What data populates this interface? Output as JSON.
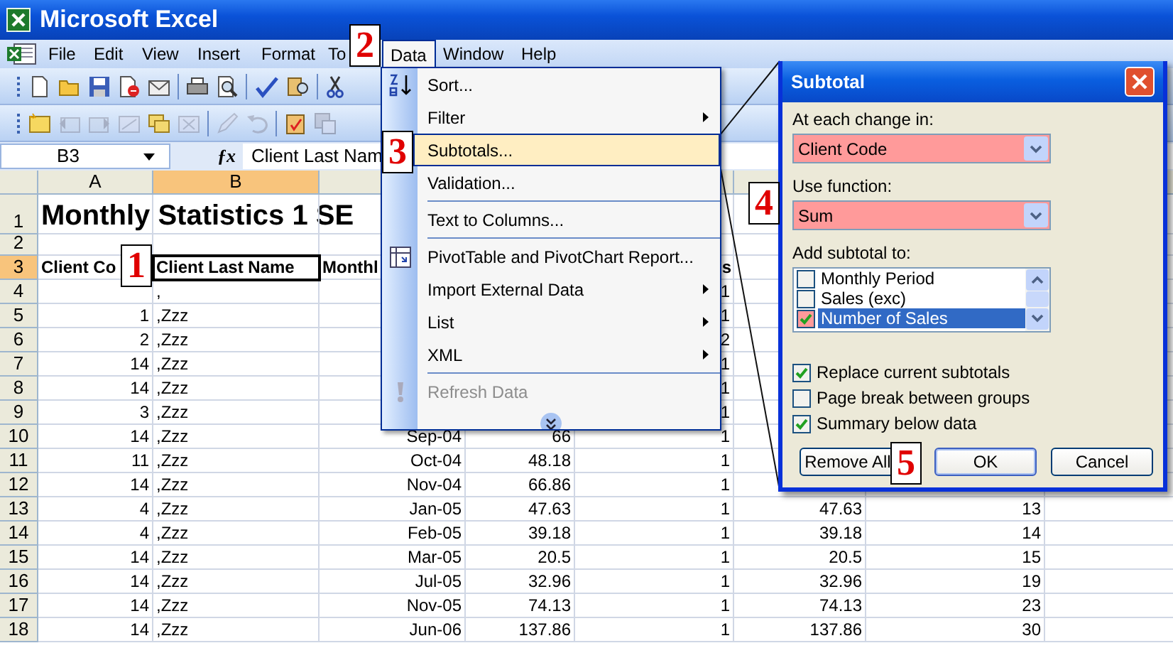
{
  "window": {
    "title": "Microsoft Excel"
  },
  "menu_bar": [
    {
      "label": "File",
      "selected": false
    },
    {
      "label": "Edit",
      "selected": false
    },
    {
      "label": "View",
      "selected": false
    },
    {
      "label": "Insert",
      "selected": false
    },
    {
      "label": "Format",
      "selected": false
    },
    {
      "label": "To",
      "selected": false
    },
    {
      "label": "Data",
      "selected": true
    },
    {
      "label": "Window",
      "selected": false
    },
    {
      "label": "Help",
      "selected": false
    }
  ],
  "name_box": "B3",
  "function_icon": "ƒx",
  "formula": "Client Last Nam",
  "sheet": {
    "columns": [
      {
        "label": "A",
        "selected": false
      },
      {
        "label": "B",
        "selected": true
      }
    ],
    "rows": [
      {
        "number": "1",
        "kind": "title",
        "selected": false,
        "cells": {
          "A": "Monthly Statistics 1 SE"
        }
      },
      {
        "number": "2",
        "kind": "data",
        "selected": false,
        "cells": {}
      },
      {
        "number": "3",
        "kind": "header",
        "selected": true,
        "cells": {
          "A": "Client Co",
          "B": "Client Last Name",
          "C": "Monthl",
          "E": "s"
        }
      },
      {
        "number": "4",
        "kind": "data",
        "selected": false,
        "cells": {
          "B": ",",
          "E": "1"
        }
      },
      {
        "number": "5",
        "kind": "data",
        "selected": false,
        "cells": {
          "A": "1",
          "B": ",Zzz",
          "E": "1"
        }
      },
      {
        "number": "6",
        "kind": "data",
        "selected": false,
        "cells": {
          "A": "2",
          "B": ",Zzz",
          "E": "2"
        }
      },
      {
        "number": "7",
        "kind": "data",
        "selected": false,
        "cells": {
          "A": "14",
          "B": ",Zzz",
          "E": "1"
        }
      },
      {
        "number": "8",
        "kind": "data",
        "selected": false,
        "cells": {
          "A": "14",
          "B": ",Zzz",
          "E": "1"
        }
      },
      {
        "number": "9",
        "kind": "data",
        "selected": false,
        "cells": {
          "A": "3",
          "B": ",Zzz",
          "E": "1"
        }
      },
      {
        "number": "10",
        "kind": "data",
        "selected": false,
        "cells": {
          "A": "14",
          "B": ",Zzz",
          "C": "Sep-04",
          "D": "66",
          "E": "1"
        }
      },
      {
        "number": "11",
        "kind": "data",
        "selected": false,
        "cells": {
          "A": "11",
          "B": ",Zzz",
          "C": "Oct-04",
          "D": "48.18",
          "E": "1"
        }
      },
      {
        "number": "12",
        "kind": "data",
        "selected": false,
        "cells": {
          "A": "14",
          "B": ",Zzz",
          "C": "Nov-04",
          "D": "66.86",
          "E": "1"
        }
      },
      {
        "number": "13",
        "kind": "data",
        "selected": false,
        "cells": {
          "A": "4",
          "B": ",Zzz",
          "C": "Jan-05",
          "D": "47.63",
          "E": "1",
          "F": "47.63",
          "G": "13"
        }
      },
      {
        "number": "14",
        "kind": "data",
        "selected": false,
        "cells": {
          "A": "4",
          "B": ",Zzz",
          "C": "Feb-05",
          "D": "39.18",
          "E": "1",
          "F": "39.18",
          "G": "14"
        }
      },
      {
        "number": "15",
        "kind": "data",
        "selected": false,
        "cells": {
          "A": "14",
          "B": ",Zzz",
          "C": "Mar-05",
          "D": "20.5",
          "E": "1",
          "F": "20.5",
          "G": "15"
        }
      },
      {
        "number": "16",
        "kind": "data",
        "selected": false,
        "cells": {
          "A": "14",
          "B": ",Zzz",
          "C": "Jul-05",
          "D": "32.96",
          "E": "1",
          "F": "32.96",
          "G": "19"
        }
      },
      {
        "number": "17",
        "kind": "data",
        "selected": false,
        "cells": {
          "A": "14",
          "B": ",Zzz",
          "C": "Nov-05",
          "D": "74.13",
          "E": "1",
          "F": "74.13",
          "G": "23"
        }
      },
      {
        "number": "18",
        "kind": "data",
        "selected": false,
        "cells": {
          "A": "14",
          "B": ",Zzz",
          "C": "Jun-06",
          "D": "137.86",
          "E": "1",
          "F": "137.86",
          "G": "30"
        }
      }
    ]
  },
  "data_menu": [
    {
      "kind": "item",
      "label": "Sort...",
      "submenu": false,
      "selected": false,
      "disabled": false
    },
    {
      "kind": "item",
      "label": "Filter",
      "submenu": true,
      "selected": false,
      "disabled": false
    },
    {
      "kind": "item",
      "label": "Subtotals...",
      "submenu": false,
      "selected": true,
      "disabled": false
    },
    {
      "kind": "item",
      "label": "Validation...",
      "submenu": false,
      "selected": false,
      "disabled": false
    },
    {
      "kind": "separator"
    },
    {
      "kind": "item",
      "label": "Text to Columns...",
      "submenu": false,
      "selected": false,
      "disabled": false
    },
    {
      "kind": "separator"
    },
    {
      "kind": "item",
      "label": "PivotTable and PivotChart Report...",
      "submenu": false,
      "selected": false,
      "disabled": false
    },
    {
      "kind": "item",
      "label": "Import External Data",
      "submenu": true,
      "selected": false,
      "disabled": false
    },
    {
      "kind": "item",
      "label": "List",
      "submenu": true,
      "selected": false,
      "disabled": false
    },
    {
      "kind": "item",
      "label": "XML",
      "submenu": true,
      "selected": false,
      "disabled": false
    },
    {
      "kind": "separator"
    },
    {
      "kind": "item",
      "label": "Refresh Data",
      "submenu": false,
      "selected": false,
      "disabled": true
    },
    {
      "kind": "more"
    }
  ],
  "dialog": {
    "title": "Subtotal",
    "change_label": "At each change in:",
    "change_value": "Client Code",
    "change_highlighted": true,
    "function_label": "Use function:",
    "function_value": "Sum",
    "function_highlighted": true,
    "add_label": "Add subtotal to:",
    "add_items": [
      {
        "label": "Monthly Period",
        "checked": false,
        "selected": false,
        "highlighted": false
      },
      {
        "label": "Sales (exc)",
        "checked": false,
        "selected": false,
        "highlighted": false
      },
      {
        "label": "Number of Sales",
        "checked": true,
        "selected": true,
        "highlighted": true
      }
    ],
    "options": [
      {
        "label": "Replace current subtotals",
        "checked": true
      },
      {
        "label": "Page break between groups",
        "checked": false
      },
      {
        "label": "Summary below data",
        "checked": true
      }
    ],
    "buttons": [
      {
        "label": "Remove All",
        "default": false
      },
      {
        "label": "OK",
        "default": true
      },
      {
        "label": "Cancel",
        "default": false
      }
    ]
  },
  "callouts": [
    {
      "label": "1"
    },
    {
      "label": "2"
    },
    {
      "label": "3"
    },
    {
      "label": "4"
    },
    {
      "label": "5"
    }
  ]
}
